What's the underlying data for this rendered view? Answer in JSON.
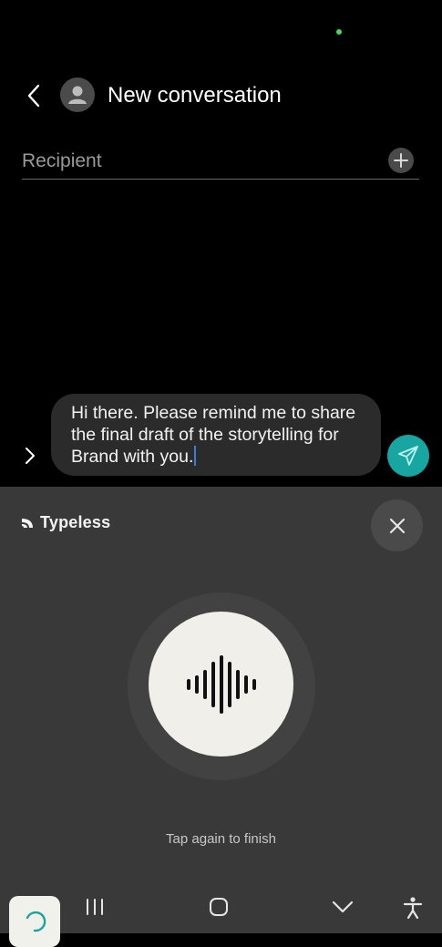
{
  "header": {
    "title": "New conversation"
  },
  "recipient": {
    "placeholder": "Recipient"
  },
  "composer": {
    "message": "Hi there. Please remind me to share the final draft of the storytelling for Brand with you."
  },
  "keyboard": {
    "brand_name": "Typeless",
    "hint": "Tap again to finish"
  },
  "colors": {
    "send_button": "#17a6a2",
    "caret": "#3f7bd9",
    "status_dot": "#3ddc5b"
  },
  "icons": {
    "back": "chevron-left-icon",
    "avatar": "person-icon",
    "add": "plus-icon",
    "expand": "chevron-right-icon",
    "send": "paper-plane-icon",
    "brand": "typeless-logo-icon",
    "close": "close-icon",
    "mic": "waveform-icon",
    "recents": "recents-icon",
    "home": "home-icon",
    "hide_keyboard": "chevron-down-icon",
    "accessibility": "accessibility-icon",
    "keyboard_tile": "loading-icon"
  }
}
